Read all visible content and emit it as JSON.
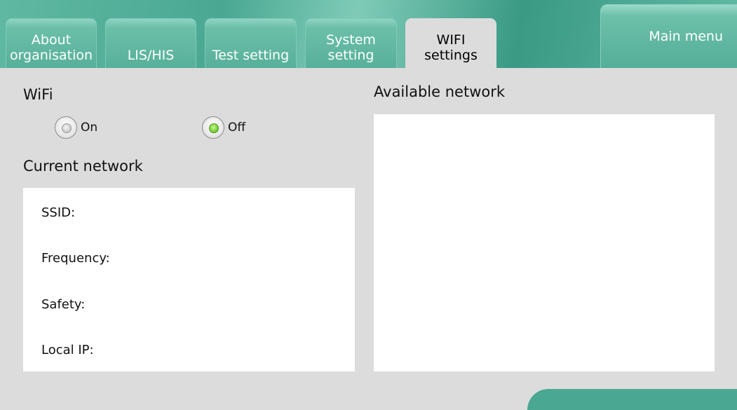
{
  "tabs": [
    {
      "label": "About\norganisation",
      "active": false
    },
    {
      "label": "LIS/HIS",
      "active": false
    },
    {
      "label": "Test setting",
      "active": false
    },
    {
      "label": "System\nsetting",
      "active": false
    },
    {
      "label": "WIFI\nsettings",
      "active": true
    }
  ],
  "main_menu_label": "Main menu",
  "wifi": {
    "heading": "WiFi",
    "on_label": "On",
    "off_label": "Off",
    "selected": "Off"
  },
  "current_network": {
    "heading": "Current network",
    "fields": [
      "SSID:",
      "Frequency:",
      "Safety:",
      "Local IP:"
    ]
  },
  "available_network": {
    "heading": "Available network",
    "items": []
  },
  "colors": {
    "accent": "#4aa892",
    "background": "#dcdcdc",
    "radio_selected": "#7fd43c"
  }
}
